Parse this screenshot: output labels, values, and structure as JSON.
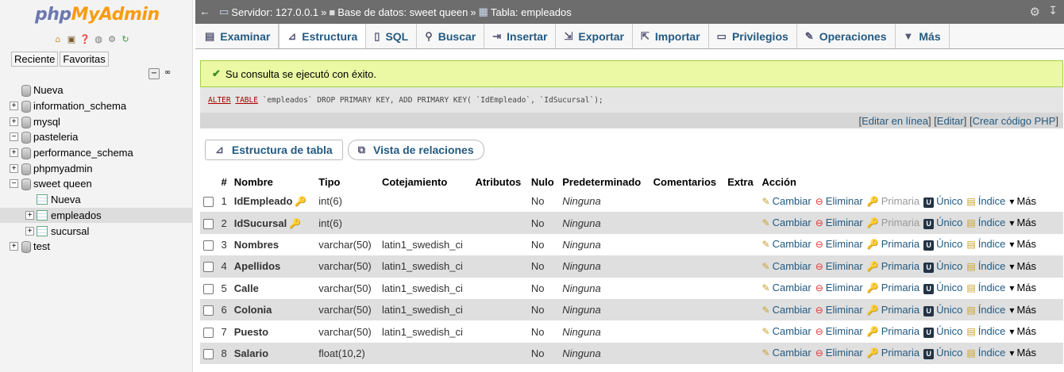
{
  "nav": {
    "logo_php": "php",
    "logo_myadmin": "MyAdmin",
    "quick_icons": [
      "home-icon",
      "logout-icon",
      "docs-icon",
      "info-icon",
      "settings-icon",
      "reload-icon"
    ],
    "tab_recent": "Reciente",
    "tab_favorites": "Favoritas",
    "collapse_all": "−",
    "link": "∞",
    "tree": [
      {
        "label": "Nueva",
        "type": "new",
        "indent": 0
      },
      {
        "label": "information_schema",
        "type": "db",
        "indent": 0
      },
      {
        "label": "mysql",
        "type": "db",
        "indent": 0
      },
      {
        "label": "pasteleria",
        "type": "db",
        "indent": 0,
        "expanded": true
      },
      {
        "label": "performance_schema",
        "type": "db",
        "indent": 0
      },
      {
        "label": "phpmyadmin",
        "type": "db",
        "indent": 0
      },
      {
        "label": "sweet queen",
        "type": "db",
        "indent": 0,
        "expanded": true
      },
      {
        "label": "Nueva",
        "type": "newtable",
        "indent": 1
      },
      {
        "label": "empleados",
        "type": "table",
        "indent": 1,
        "selected": true
      },
      {
        "label": "sucursal",
        "type": "table",
        "indent": 1
      },
      {
        "label": "test",
        "type": "db",
        "indent": 0
      }
    ]
  },
  "breadcrumb": {
    "server": "Servidor: 127.0.0.1",
    "sep1": "»",
    "database": "Base de datos: sweet queen",
    "sep2": "»",
    "table": "Tabla: empleados"
  },
  "tabs": [
    {
      "label": "Examinar",
      "icon": "browse-icon"
    },
    {
      "label": "Estructura",
      "icon": "structure-icon",
      "active": true
    },
    {
      "label": "SQL",
      "icon": "sql-icon"
    },
    {
      "label": "Buscar",
      "icon": "search-icon"
    },
    {
      "label": "Insertar",
      "icon": "insert-icon"
    },
    {
      "label": "Exportar",
      "icon": "export-icon"
    },
    {
      "label": "Importar",
      "icon": "import-icon"
    },
    {
      "label": "Privilegios",
      "icon": "privileges-icon"
    },
    {
      "label": "Operaciones",
      "icon": "wrench-icon"
    },
    {
      "label": "Más",
      "icon": "more-icon"
    }
  ],
  "success_message": "Su consulta se ejecutó con éxito.",
  "sql": {
    "kw1": "ALTER",
    "kw2": "TABLE",
    "rest": " `empleados` DROP PRIMARY KEY, ADD PRIMARY KEY( `IdEmpleado`, `IdSucursal`);"
  },
  "sql_links": {
    "bracket_open": "[",
    "inline_edit": "Editar en línea",
    "sep": "] [",
    "edit": "Editar",
    "sep2": "] [",
    "create_php": "Crear código PHP",
    "bracket_close": "]"
  },
  "subtabs": {
    "table_structure": "Estructura de tabla",
    "relation_view": "Vista de relaciones"
  },
  "columns": [
    "#",
    "Nombre",
    "Tipo",
    "Cotejamiento",
    "Atributos",
    "Nulo",
    "Predeterminado",
    "Comentarios",
    "Extra",
    "Acción"
  ],
  "rows": [
    {
      "n": "1",
      "name": "IdEmpleado",
      "key": true,
      "type": "int(6)",
      "collation": "",
      "attrs": "",
      "null": "No",
      "default": "Ninguna",
      "comments": "",
      "extra": "",
      "primary_greyed": true
    },
    {
      "n": "2",
      "name": "IdSucursal",
      "key": true,
      "type": "int(6)",
      "collation": "",
      "attrs": "",
      "null": "No",
      "default": "Ninguna",
      "comments": "",
      "extra": "",
      "primary_greyed": true
    },
    {
      "n": "3",
      "name": "Nombres",
      "key": false,
      "type": "varchar(50)",
      "collation": "latin1_swedish_ci",
      "attrs": "",
      "null": "No",
      "default": "Ninguna",
      "comments": "",
      "extra": "",
      "primary_greyed": false
    },
    {
      "n": "4",
      "name": "Apellidos",
      "key": false,
      "type": "varchar(50)",
      "collation": "latin1_swedish_ci",
      "attrs": "",
      "null": "No",
      "default": "Ninguna",
      "comments": "",
      "extra": "",
      "primary_greyed": false
    },
    {
      "n": "5",
      "name": "Calle",
      "key": false,
      "type": "varchar(50)",
      "collation": "latin1_swedish_ci",
      "attrs": "",
      "null": "No",
      "default": "Ninguna",
      "comments": "",
      "extra": "",
      "primary_greyed": false
    },
    {
      "n": "6",
      "name": "Colonia",
      "key": false,
      "type": "varchar(50)",
      "collation": "latin1_swedish_ci",
      "attrs": "",
      "null": "No",
      "default": "Ninguna",
      "comments": "",
      "extra": "",
      "primary_greyed": false
    },
    {
      "n": "7",
      "name": "Puesto",
      "key": false,
      "type": "varchar(50)",
      "collation": "latin1_swedish_ci",
      "attrs": "",
      "null": "No",
      "default": "Ninguna",
      "comments": "",
      "extra": "",
      "primary_greyed": false
    },
    {
      "n": "8",
      "name": "Salario",
      "key": false,
      "type": "float(10,2)",
      "collation": "",
      "attrs": "",
      "null": "No",
      "default": "Ninguna",
      "comments": "",
      "extra": "",
      "primary_greyed": false
    }
  ],
  "actions": {
    "change": "Cambiar",
    "drop": "Eliminar",
    "primary": "Primaria",
    "unique": "Único",
    "index": "Índice",
    "more": "Más"
  }
}
